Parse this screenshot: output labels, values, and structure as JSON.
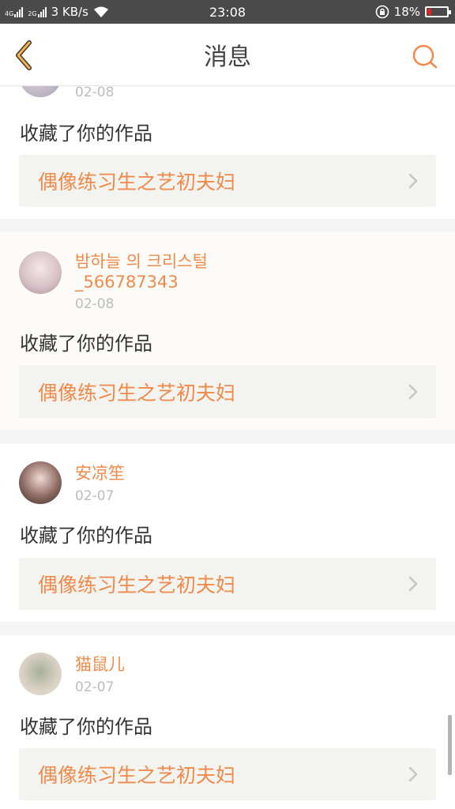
{
  "status_bar": {
    "net_1": "4G",
    "net_2": "2G",
    "speed": "3 KB/s",
    "time": "23:08",
    "battery_pct": "18%",
    "battery_color": "#e22424"
  },
  "header": {
    "title": "消息",
    "back_icon": "chevron-left-icon",
    "search_icon": "search-icon",
    "accent": "#f5b342"
  },
  "messages": [
    {
      "user": "",
      "user_id": "",
      "date": "02-08",
      "action": "收藏了你的作品",
      "work_title": "偶像练习生之艺初夫妇"
    },
    {
      "user": "밤하늘 의 크리스털",
      "user_id": "_566787343",
      "date": "02-08",
      "action": "收藏了你的作品",
      "work_title": "偶像练习生之艺初夫妇"
    },
    {
      "user": "安凉笙",
      "user_id": "",
      "date": "02-07",
      "action": "收藏了你的作品",
      "work_title": "偶像练习生之艺初夫妇"
    },
    {
      "user": "猫鼠儿",
      "user_id": "",
      "date": "02-07",
      "action": "收藏了你的作品",
      "work_title": "偶像练习生之艺初夫妇"
    }
  ],
  "colors": {
    "accent_orange": "#f08a4b",
    "date_gray": "#bdbdbd",
    "box_bg": "#f3f3ef"
  }
}
